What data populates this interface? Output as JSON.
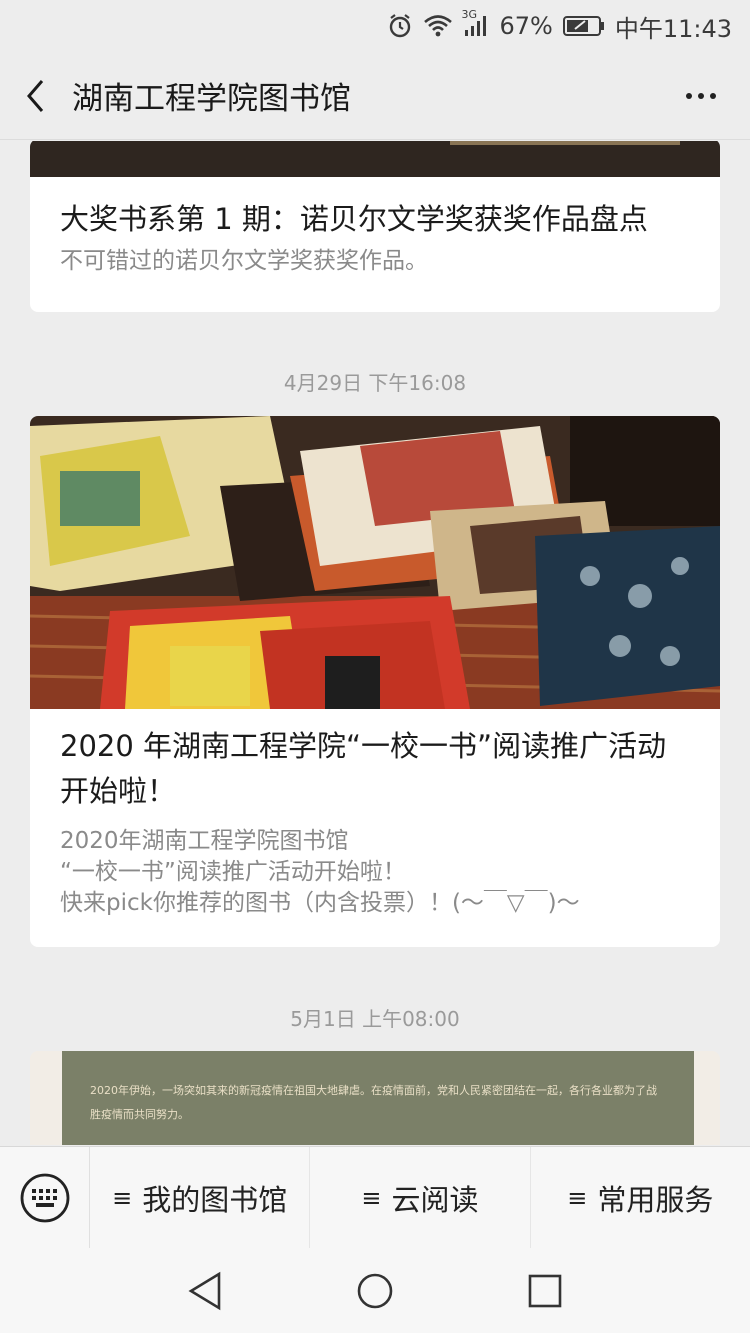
{
  "status_bar": {
    "battery": "67%",
    "time": "中午11:43",
    "network": "3G"
  },
  "header": {
    "title": "湖南工程学院图书馆"
  },
  "feed": {
    "articles": [
      {
        "title": "大奖书系第 1 期：诺贝尔文学奖获奖作品盘点",
        "desc": "不可错过的诺贝尔文学奖获奖作品。"
      },
      {
        "timestamp": "4月29日 下午16:08",
        "title": "2020 年湖南工程学院“一校一书”阅读推广活动开始啦！",
        "desc_lines": [
          "2020年湖南工程学院图书馆",
          "“一校一书”阅读推广活动开始啦！",
          "快来pick你推荐的图书（内含投票）！(～￣▽￣)～"
        ]
      },
      {
        "timestamp": "5月1日 上午08:00",
        "preview_text": "2020年伊始，一场突如其来的新冠疫情在祖国大地肆虐。在疫情面前，党和人民紧密团结在一起，各行各业都为了战胜疫情而共同努力。"
      }
    ]
  },
  "menu": {
    "items": [
      {
        "label": "我的图书馆",
        "icon": "menu-lines-icon"
      },
      {
        "label": "云阅读",
        "icon": "menu-lines-icon"
      },
      {
        "label": "常用服务",
        "icon": "menu-lines-icon"
      }
    ]
  }
}
